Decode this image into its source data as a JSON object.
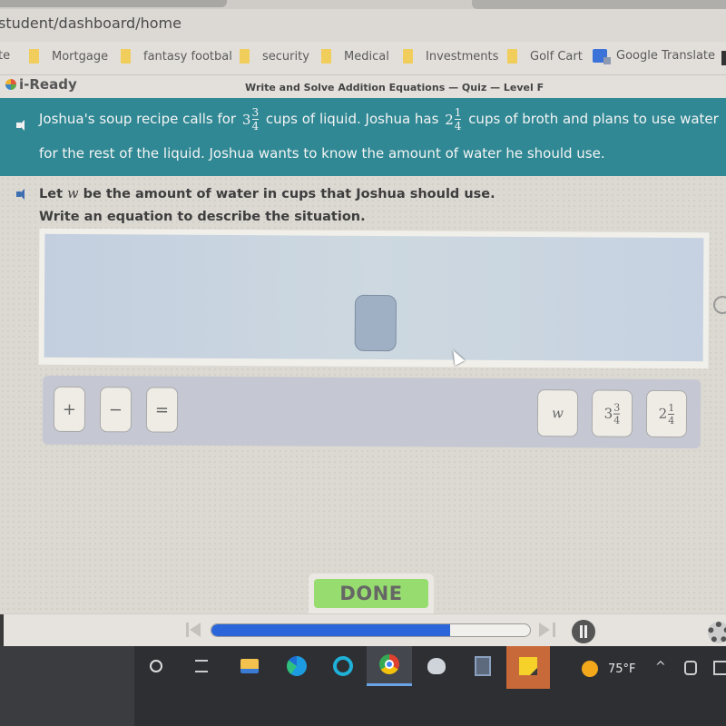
{
  "browser": {
    "url": "student/dashboard/home",
    "bookmarks": [
      {
        "label": "te",
        "icon": "none"
      },
      {
        "label": "Mortgage",
        "icon": "folder-icon"
      },
      {
        "label": "fantasy footbal",
        "icon": "folder-icon"
      },
      {
        "label": "security",
        "icon": "folder-icon"
      },
      {
        "label": "Medical",
        "icon": "folder-icon"
      },
      {
        "label": "Investments",
        "icon": "folder-icon"
      },
      {
        "label": "Golf Cart",
        "icon": "folder-icon"
      },
      {
        "label": "Google Translate",
        "icon": "google-translate-icon"
      }
    ]
  },
  "app": {
    "logo": "i-Ready",
    "quiz_title": "Write and Solve Addition Equations — Quiz — Level F"
  },
  "question": {
    "part1": "Joshua's soup recipe calls for",
    "mixed1": {
      "whole": "3",
      "num": "3",
      "den": "4"
    },
    "part2": "cups of liquid. Joshua has",
    "mixed2": {
      "whole": "2",
      "num": "1",
      "den": "4"
    },
    "part3": "cups of broth and plans to use water",
    "line2": "for the rest of the liquid. Joshua wants to know the amount of water he should use."
  },
  "prompt": {
    "line1_a": "Let",
    "variable": "w",
    "line1_b": "be the amount of water in cups that Joshua should use.",
    "line2": "Write an equation to describe the situation."
  },
  "tiles": {
    "operators": [
      {
        "symbol": "+",
        "name": "plus"
      },
      {
        "symbol": "−",
        "name": "minus"
      },
      {
        "symbol": "=",
        "name": "equals"
      }
    ],
    "variable": "w",
    "value1": {
      "whole": "3",
      "num": "3",
      "den": "4"
    },
    "value2": {
      "whole": "2",
      "num": "1",
      "den": "4"
    }
  },
  "done_label": "DONE",
  "player": {
    "progress_percent": 75
  },
  "taskbar": {
    "apps": [
      "cortana",
      "task-view",
      "file-explorer",
      "edge",
      "alexa",
      "chrome",
      "snipping-tool",
      "calculator",
      "sticky-notes"
    ],
    "active_app": "chrome",
    "weather_temp": "75°F",
    "colors": {
      "accent": "#6aa4e6",
      "banner": "#2f8894",
      "done": "#97dc6f",
      "progress": "#2a66d9"
    }
  }
}
